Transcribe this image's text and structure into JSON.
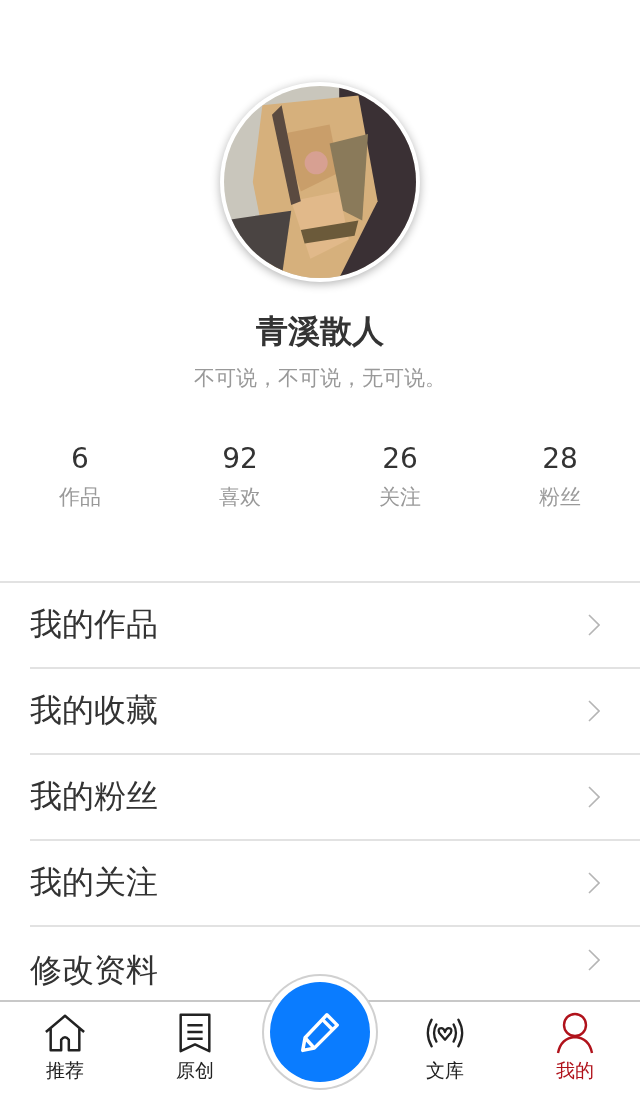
{
  "profile": {
    "name": "青溪散人",
    "bio": "不可说，不可说，无可说。"
  },
  "stats": [
    {
      "value": "6",
      "label": "作品"
    },
    {
      "value": "92",
      "label": "喜欢"
    },
    {
      "value": "26",
      "label": "关注"
    },
    {
      "value": "28",
      "label": "粉丝"
    }
  ],
  "menu": [
    {
      "label": "我的作品"
    },
    {
      "label": "我的收藏"
    },
    {
      "label": "我的粉丝"
    },
    {
      "label": "我的关注"
    },
    {
      "label": "修改资料"
    }
  ],
  "tab_bar": [
    {
      "kind": "home",
      "label": "推荐",
      "selected": false
    },
    {
      "kind": "doc",
      "label": "原创",
      "selected": false
    },
    {
      "kind": "compose"
    },
    {
      "kind": "radio",
      "label": "文库",
      "selected": false
    },
    {
      "kind": "user",
      "label": "我的",
      "selected": true
    }
  ]
}
